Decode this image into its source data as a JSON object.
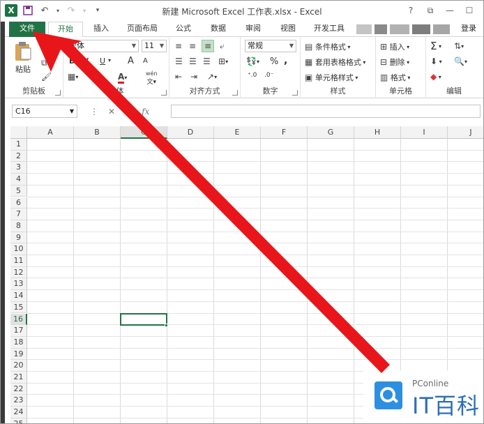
{
  "window": {
    "title": "新建 Microsoft Excel 工作表.xlsx - Excel",
    "app_icon_letter": "X",
    "controls": [
      "?",
      "⧉",
      "—",
      "☐"
    ]
  },
  "tabs": {
    "file": "文件",
    "items": [
      "开始",
      "插入",
      "页面布局",
      "公式",
      "数据",
      "审阅",
      "视图",
      "开发工具"
    ],
    "active": "开始",
    "login": "登录"
  },
  "ribbon": {
    "clipboard": {
      "paste": "粘贴",
      "label": "剪贴板"
    },
    "font": {
      "name": "宋体",
      "size": "11",
      "bold": "B",
      "italic": "I",
      "underline": "U",
      "grow": "A",
      "shrink": "A",
      "label": "字体",
      "phonetic": "wén"
    },
    "alignment": {
      "label": "对齐方式"
    },
    "number": {
      "format": "常规",
      "percent": "%",
      "comma": ",",
      "label": "数字"
    },
    "styles": {
      "conditional": "条件格式",
      "table": "套用表格格式",
      "cell": "单元格样式",
      "label": "样式"
    },
    "cells": {
      "insert": "插入",
      "delete": "删除",
      "format": "格式",
      "label": "单元格"
    },
    "editing": {
      "label": "编辑"
    }
  },
  "formula_bar": {
    "name_box": "C16",
    "formula": ""
  },
  "grid": {
    "columns": [
      "A",
      "B",
      "C",
      "D",
      "E",
      "F",
      "G",
      "H",
      "I",
      "J"
    ],
    "rows": [
      "1",
      "2",
      "3",
      "4",
      "5",
      "6",
      "7",
      "8",
      "9",
      "10",
      "11",
      "12",
      "13",
      "14",
      "15",
      "16",
      "17",
      "18",
      "19",
      "20",
      "21",
      "22",
      "23",
      "24",
      "25"
    ],
    "selected_column": "C",
    "selected_row": "16"
  },
  "watermark": {
    "brand_small": "PConline",
    "brand_big": "IT百科"
  },
  "colors": {
    "excel_green": "#217346",
    "annotation_red": "#e8161a",
    "watermark_blue": "#2d6fb7"
  }
}
